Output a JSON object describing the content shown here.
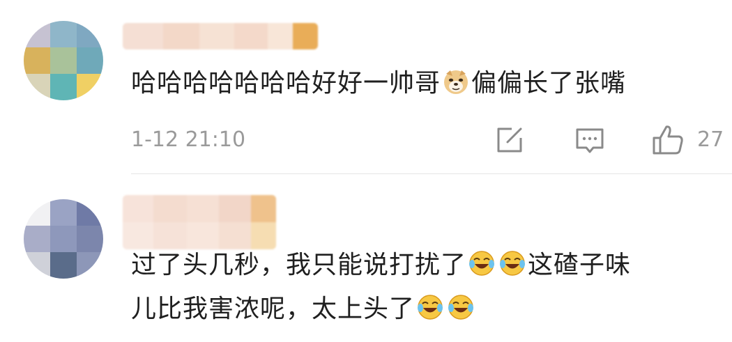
{
  "comments": [
    {
      "text_part1": "哈哈哈哈哈哈哈好好一帅哥",
      "emoji_mid": "doge",
      "text_part2": "偏偏长了张嘴",
      "timestamp": "1-12 21:10",
      "like_count": "27",
      "icons": {
        "share": "share-icon",
        "reply": "comment-icon",
        "like": "thumbs-up-icon"
      }
    },
    {
      "line1_part1": "过了头几秒，我只能说打扰了",
      "line1_emoji": "laugh-cry",
      "line1_part2": "这碴子味",
      "line2_part1": "儿比我害浓呢，太上头了",
      "line2_emoji": "laugh-cry"
    }
  ],
  "colors": {
    "text": "#1f1f1f",
    "meta": "#9a9a9a",
    "icon": "#8a8a8a",
    "divider": "#e6e6e6"
  }
}
